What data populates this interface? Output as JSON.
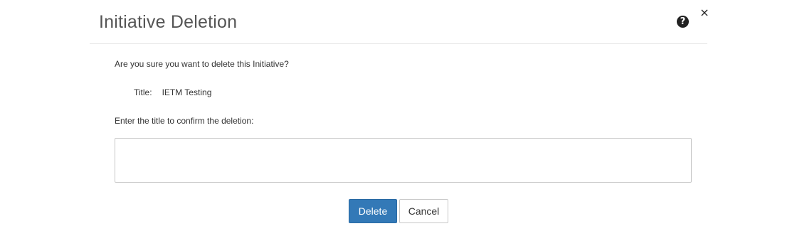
{
  "dialog": {
    "title": "Initiative Deletion",
    "help_icon": "question-circle-icon",
    "help_glyph": "?",
    "close_icon": "close-icon",
    "close_glyph": "×"
  },
  "body": {
    "question": "Are you sure you want to delete this Initiative?",
    "title_label": "Title:",
    "title_value": "IETM Testing",
    "confirm_label": "Enter the title to confirm the deletion:",
    "confirm_input": {
      "value": "",
      "placeholder": ""
    }
  },
  "footer": {
    "delete_label": "Delete",
    "cancel_label": "Cancel"
  },
  "colors": {
    "primary": "#3379b7",
    "title_text": "#555555",
    "border": "#c8c8c8"
  }
}
